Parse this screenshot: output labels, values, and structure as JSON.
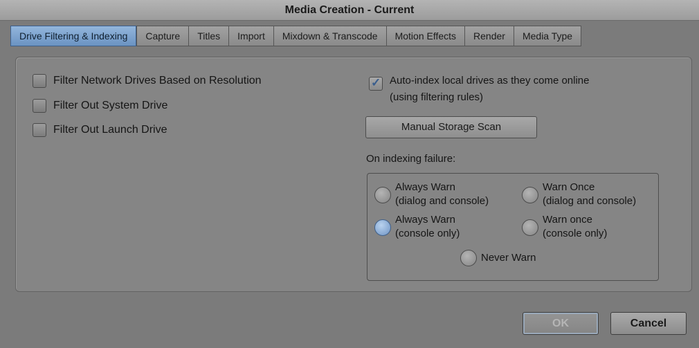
{
  "window": {
    "title": "Media Creation - Current"
  },
  "tabs": [
    {
      "label": "Drive Filtering & Indexing"
    },
    {
      "label": "Capture"
    },
    {
      "label": "Titles"
    },
    {
      "label": "Import"
    },
    {
      "label": "Mixdown & Transcode"
    },
    {
      "label": "Motion Effects"
    },
    {
      "label": "Render"
    },
    {
      "label": "Media Type"
    }
  ],
  "active_tab": "Drive Filtering & Indexing",
  "filters": [
    {
      "label": "Filter Network Drives Based on Resolution",
      "checked": false
    },
    {
      "label": "Filter Out System Drive",
      "checked": false
    },
    {
      "label": "Filter Out Launch Drive",
      "checked": false
    }
  ],
  "auto_index": {
    "line1": "Auto-index local drives as they come online",
    "line2": "(using filtering rules)",
    "checked": true
  },
  "manual_scan_button": "Manual Storage Scan",
  "indexing_failure": {
    "label": "On indexing failure:",
    "options": [
      {
        "line1": "Always Warn",
        "line2": "(dialog and console)",
        "selected": false
      },
      {
        "line1": "Warn Once",
        "line2": "(dialog and console)",
        "selected": false
      },
      {
        "line1": "Always Warn",
        "line2": "(console only)",
        "selected": true
      },
      {
        "line1": "Warn once",
        "line2": "(console only)",
        "selected": false
      },
      {
        "line1": "Never Warn",
        "line2": "",
        "selected": false
      }
    ]
  },
  "footer": {
    "ok": "OK",
    "cancel": "Cancel"
  },
  "colors": {
    "active_tab": "#7fa4d0",
    "background": "#7b7b7b",
    "panel": "#858585"
  }
}
